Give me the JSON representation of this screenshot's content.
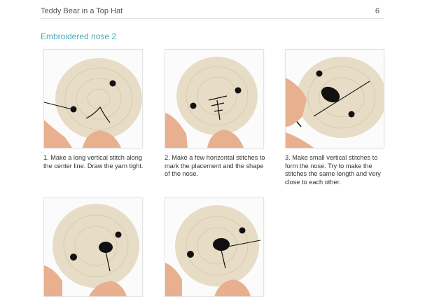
{
  "header": {
    "title": "Teddy Bear in a Top Hat",
    "page_number": "6"
  },
  "section": {
    "title": "Embroidered nose 2"
  },
  "steps": [
    {
      "caption": "1. Make a long vertical stitch along the center line. Draw the yarn tight."
    },
    {
      "caption": "2. Make a few horizontal stitches to mark the placement and the shape of the nose."
    },
    {
      "caption": "3. Make small vertical stitches to form the nose. Try to make the stitches the same length and very close to each other."
    },
    {
      "caption": ""
    },
    {
      "caption": ""
    }
  ],
  "colors": {
    "accent": "#4aa9b4",
    "yarn": "#e7dcc6",
    "skin": "#e8b08f"
  }
}
